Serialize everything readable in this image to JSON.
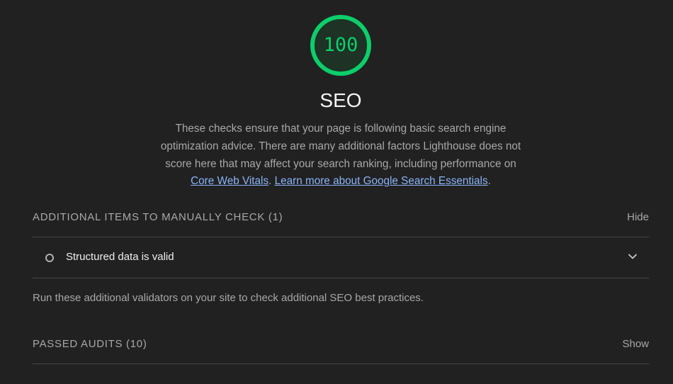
{
  "score": {
    "value": "100",
    "fraction": 1.0,
    "color": "#0cce6b"
  },
  "category": {
    "title": "SEO",
    "description": "These checks ensure that your page is following basic search engine optimization advice. There are many additional factors Lighthouse does not score here that may affect your search ranking, including performance on ",
    "link_core_web_vitals": "Core Web Vitals",
    "description_sep": ". ",
    "link_learn_more": "Learn more about Google Search Essentials",
    "description_end": "."
  },
  "manual_group": {
    "title": "ADDITIONAL ITEMS TO MANUALLY CHECK (1)",
    "toggle_label": "Hide",
    "audits": [
      {
        "title": "Structured data is valid",
        "icon": "chevron-down-icon"
      }
    ],
    "description": "Run these additional validators on your site to check additional SEO best practices."
  },
  "passed_group": {
    "title": "PASSED AUDITS (10)",
    "toggle_label": "Show"
  },
  "colors": {
    "background": "#212121",
    "link": "#8ab4f8",
    "pass": "#0cce6b"
  }
}
